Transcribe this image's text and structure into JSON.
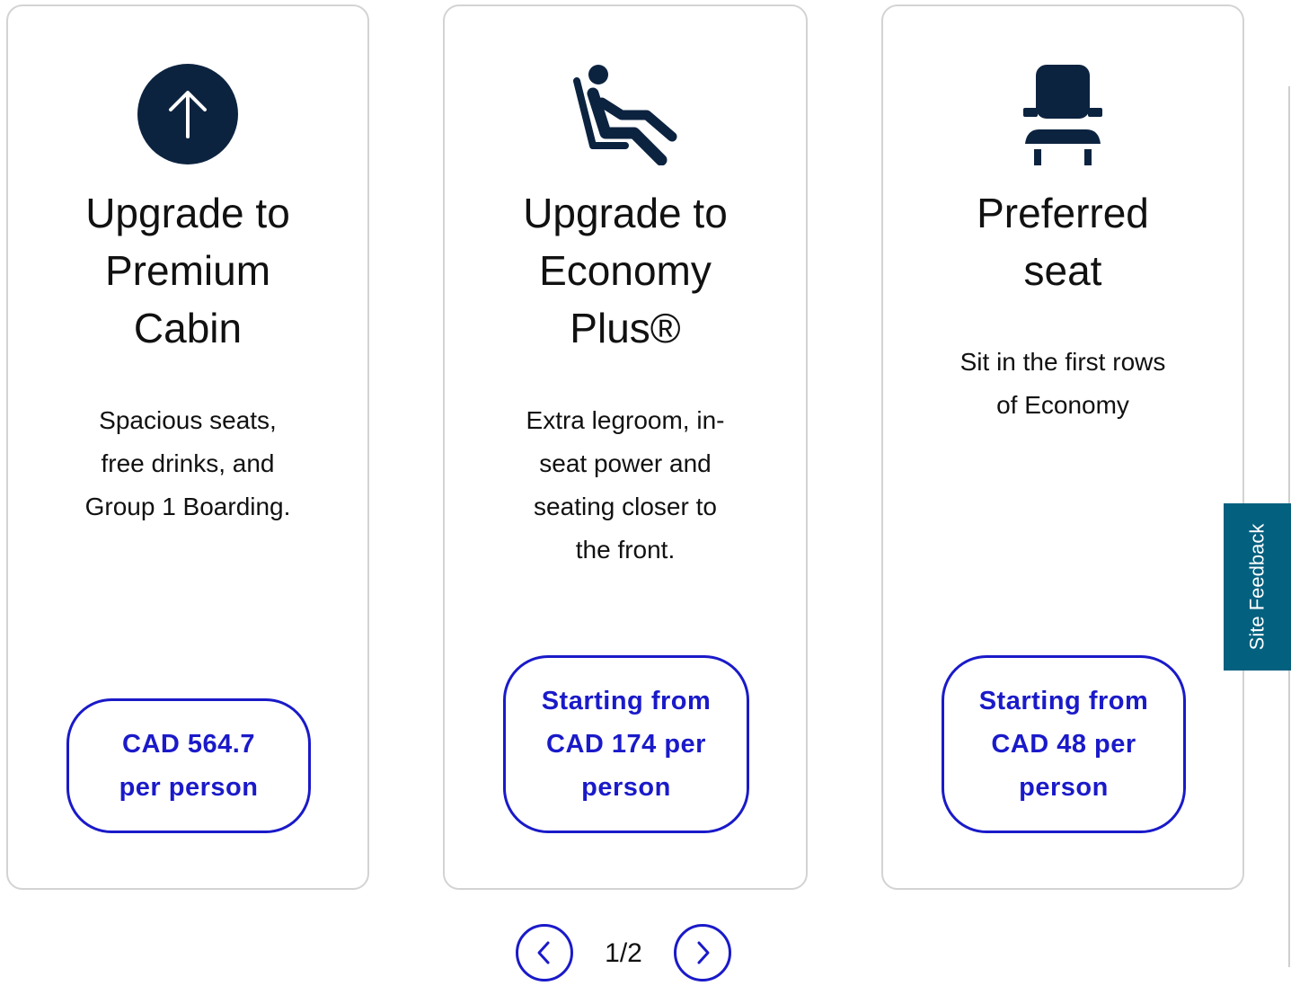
{
  "cards": [
    {
      "title_lines": [
        "Upgrade to",
        "Premium",
        "Cabin"
      ],
      "description_lines": [
        "Spacious seats,",
        "free drinks, and",
        "Group 1 Boarding."
      ],
      "price_lines": [
        "CAD 564.7",
        "per person"
      ],
      "icon": "upgrade-arrow-icon"
    },
    {
      "title_lines": [
        "Upgrade to",
        "Economy",
        "Plus®"
      ],
      "description_lines": [
        "Extra legroom, in-",
        "seat power and",
        "seating closer to",
        "the front."
      ],
      "price_lines": [
        "Starting from",
        "CAD 174 per",
        "person"
      ],
      "icon": "reclined-seat-person-icon"
    },
    {
      "title_lines": [
        "Preferred",
        "seat"
      ],
      "description_lines": [
        "Sit in the first rows",
        "of Economy"
      ],
      "price_lines": [
        "Starting from",
        "CAD 48 per",
        "person"
      ],
      "icon": "seat-icon"
    }
  ],
  "pager": {
    "current_label": "1/2",
    "prev_icon": "chevron-left-icon",
    "next_icon": "chevron-right-icon"
  },
  "feedback": {
    "label": "Site Feedback"
  },
  "colors": {
    "accent": "#1a1ac9",
    "icon_navy": "#0c2340",
    "card_border": "#d3d3d3",
    "feedback_bg": "#04607f"
  }
}
